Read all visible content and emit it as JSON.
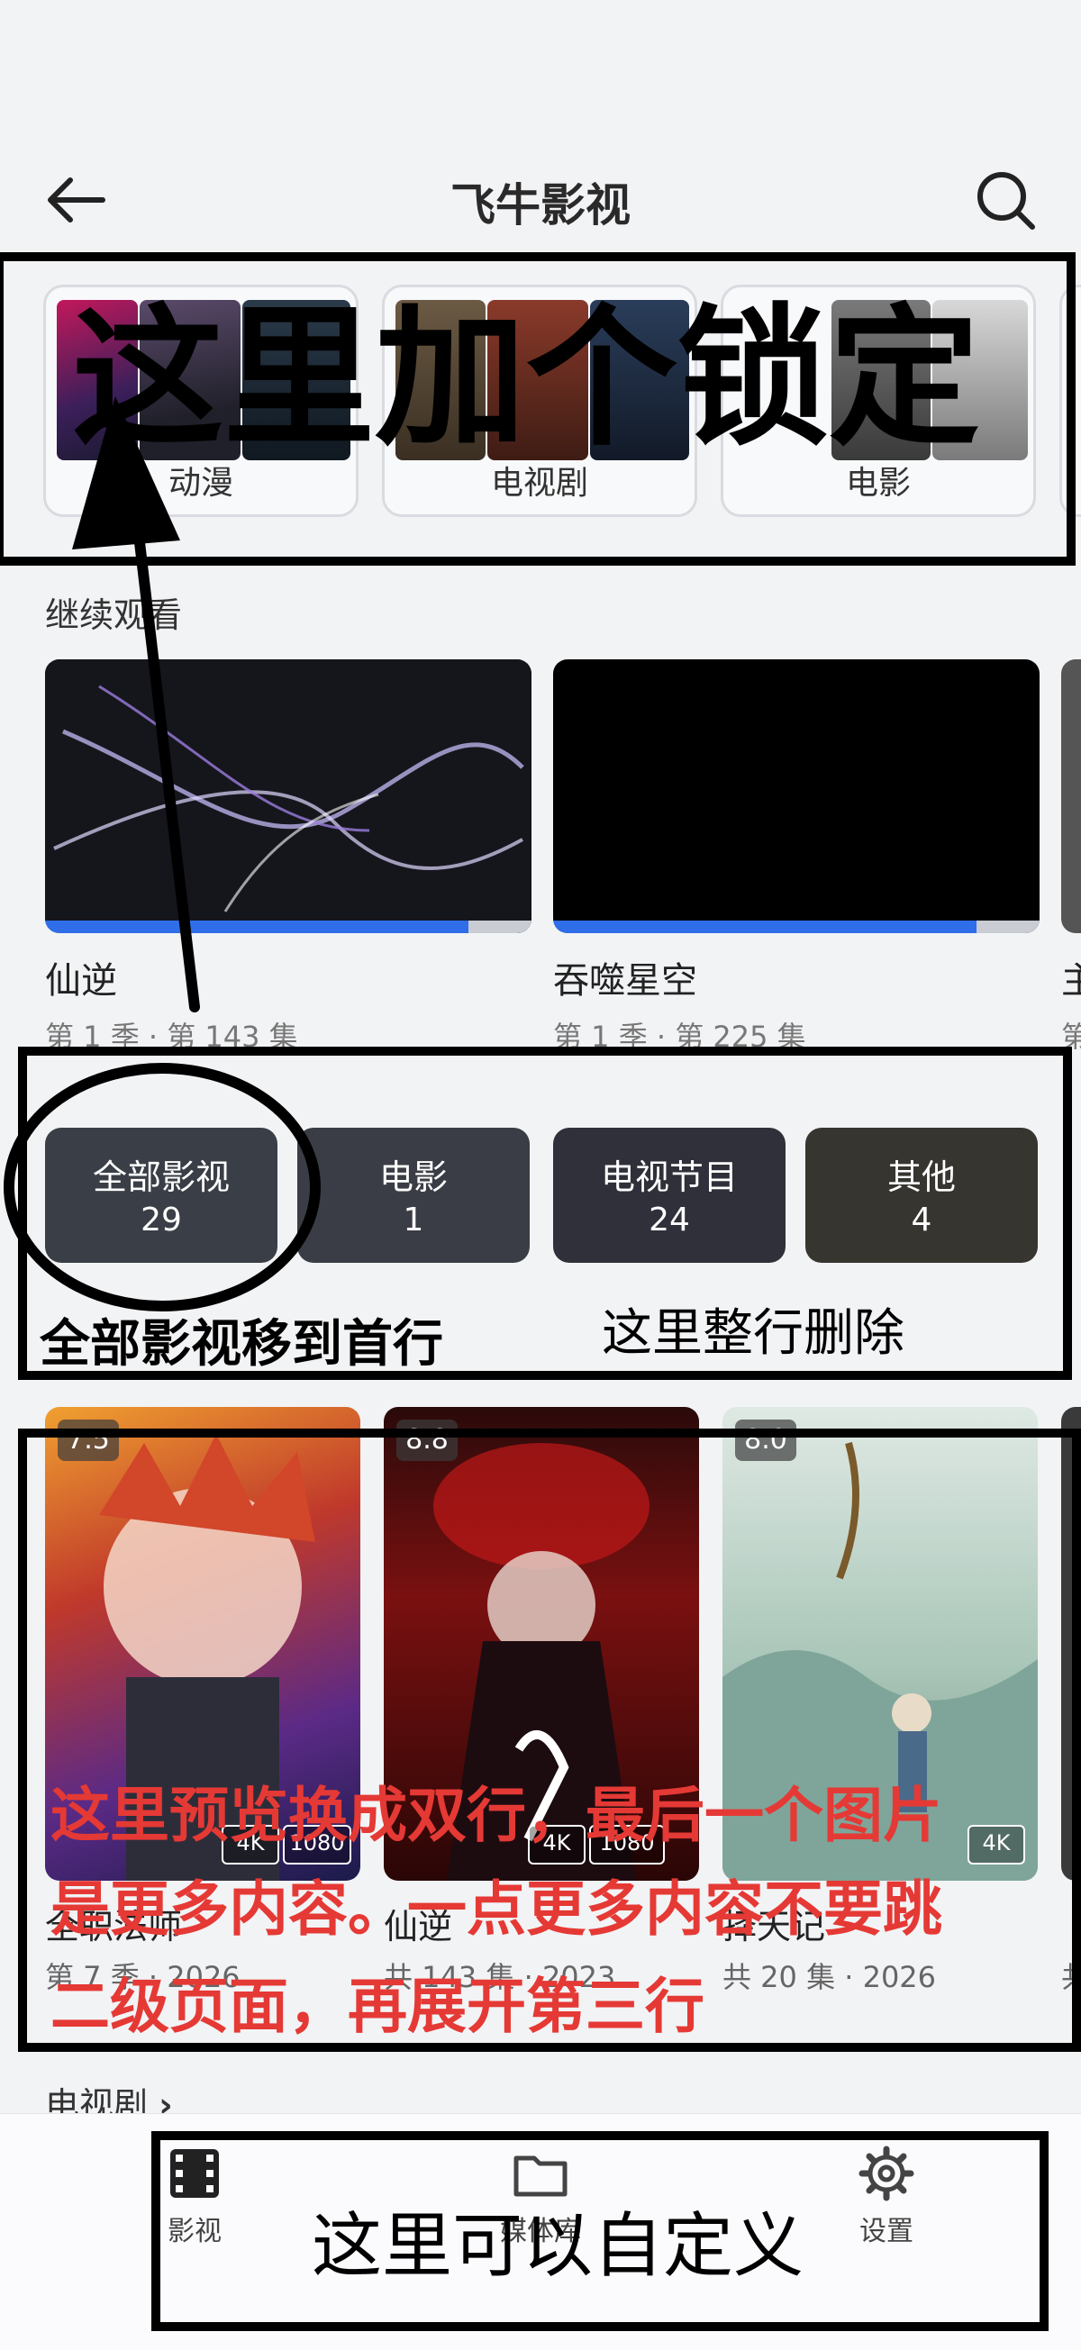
{
  "header": {
    "title": "飞牛影视"
  },
  "categories": [
    {
      "label": "动漫"
    },
    {
      "label": "电视剧"
    },
    {
      "label": "电影"
    }
  ],
  "continue_watching": {
    "heading": "继续观看",
    "items": [
      {
        "title": "仙逆",
        "episode": "第 1 季 · 第 143 集",
        "progress": 0.87
      },
      {
        "title": "吞噬星空",
        "episode": "第 1 季 · 第 225 集",
        "progress": 0.87
      },
      {
        "title": "主",
        "episode": "第"
      }
    ]
  },
  "library": [
    {
      "label": "全部影视",
      "count": "29",
      "color": "#3a3e46"
    },
    {
      "label": "电影",
      "count": "1",
      "color": "#3a3d45"
    },
    {
      "label": "电视节目",
      "count": "24",
      "color": "#2f3039"
    },
    {
      "label": "其他",
      "count": "4",
      "color": "#37352f"
    }
  ],
  "posters": [
    {
      "title": "全职法师",
      "sub": "第 7 季 · 2026",
      "rating": "7.5",
      "badges": [
        "4K",
        "1080"
      ]
    },
    {
      "title": "仙逆",
      "sub": "共 143 集 · 2023",
      "rating": "8.8",
      "badges": [
        "4K",
        "1080"
      ]
    },
    {
      "title": "择天记",
      "sub": "共 20 集 · 2026",
      "rating": "8.0",
      "badges": [
        "4K"
      ]
    },
    {
      "title": "",
      "sub": "共"
    }
  ],
  "tv_section": {
    "heading": "电视剧"
  },
  "bottom_nav": [
    {
      "label": "影视",
      "icon": "film-icon"
    },
    {
      "label": "媒体库",
      "icon": "folder-icon"
    },
    {
      "label": "设置",
      "icon": "gear-icon"
    }
  ],
  "annotations": {
    "lock": "这里加个锁定",
    "move_all": "全部影视移到首行",
    "delete_row": "这里整行删除",
    "preview_line1": "这里预览换成双行，最后一个图片",
    "preview_line2": "是更多内容。一点更多内容不要跳",
    "preview_line3": "二级页面，再展开第三行",
    "customize": "这里可以自定义"
  },
  "colors": {
    "accent": "#2f6ee8",
    "annotation_red": "#e53935"
  }
}
